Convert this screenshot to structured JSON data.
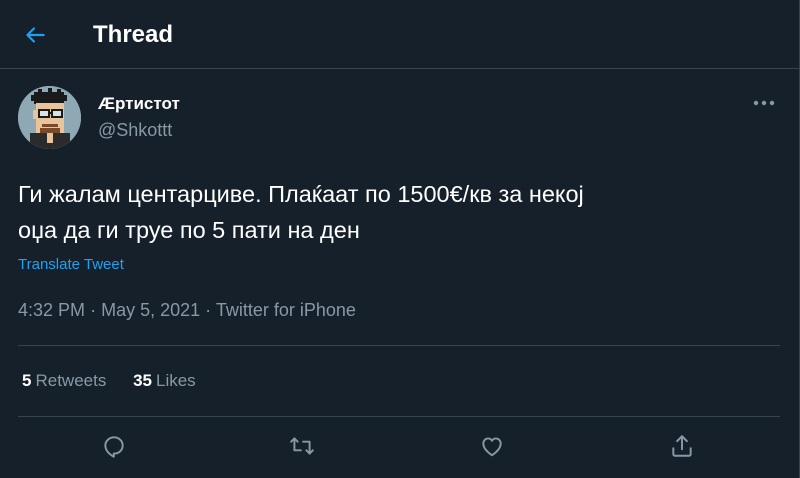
{
  "header": {
    "back_icon": "arrow-left-icon",
    "title": "Thread"
  },
  "tweet": {
    "author": {
      "display_name": "Æртистот",
      "handle": "@Shkottt",
      "avatar": "pixel-art-character-avatar"
    },
    "more_icon": "more-horizontal-icon",
    "text_line1": "Ги жалам центарциве. Плаќаат по 1500€/кв за некој",
    "text_line2": "оџа да ги труе по 5 пати на ден",
    "translate_label": "Translate Tweet",
    "time": "4:32 PM",
    "date": "May 5, 2021",
    "separator": "·",
    "source": "Twitter for iPhone",
    "stats": {
      "retweets_count": "5",
      "retweets_label": "Retweets",
      "likes_count": "35",
      "likes_label": "Likes"
    },
    "actions": {
      "reply_icon": "reply-icon",
      "retweet_icon": "retweet-icon",
      "like_icon": "heart-icon",
      "share_icon": "share-icon"
    }
  },
  "colors": {
    "background": "#15202b",
    "border": "#38444d",
    "secondary_text": "#8899a6",
    "accent": "#1da1f2",
    "primary_text": "#ffffff"
  }
}
